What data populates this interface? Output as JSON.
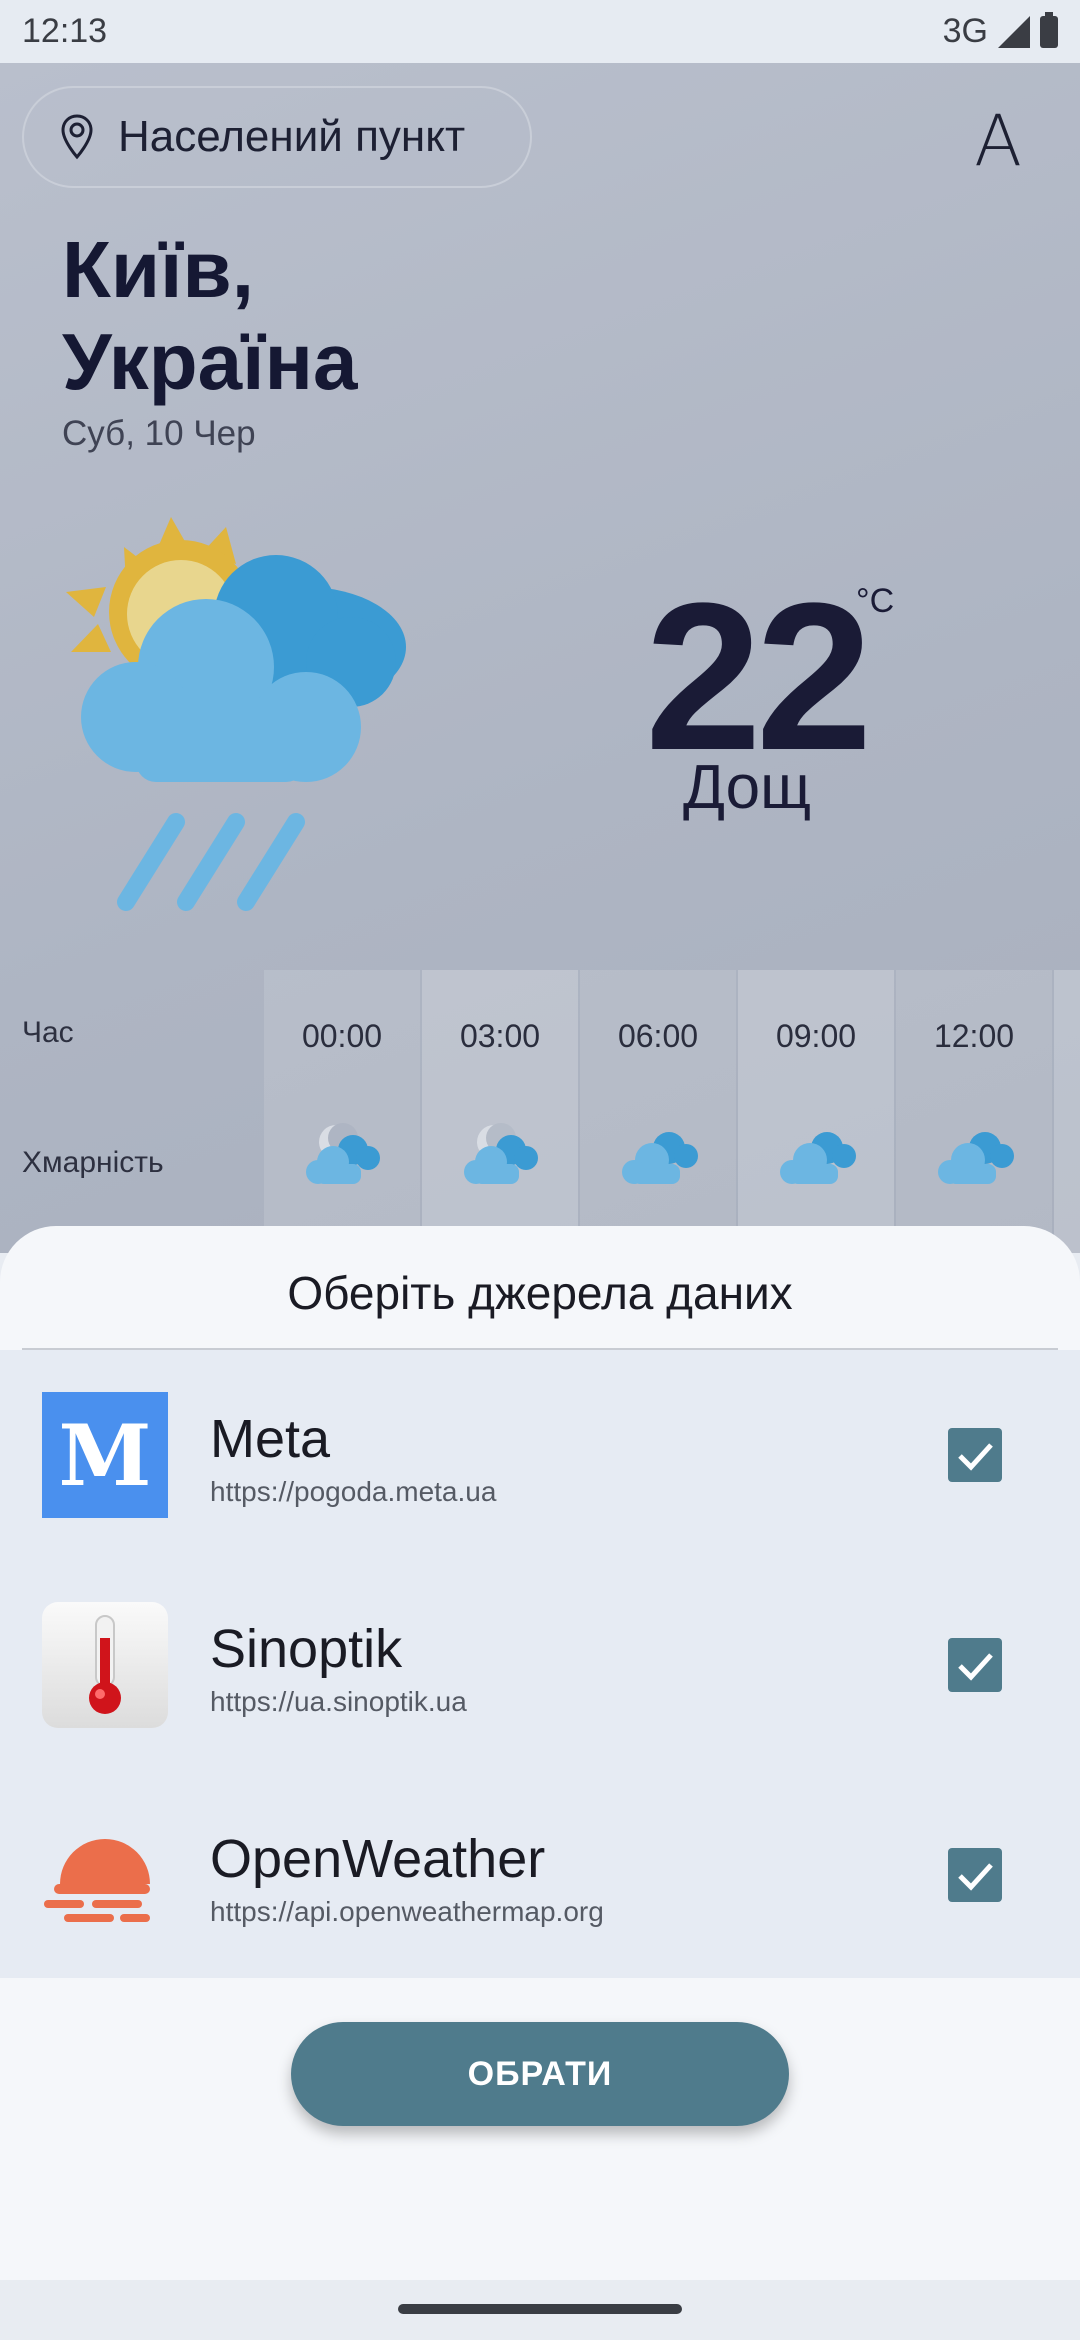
{
  "status_bar": {
    "time": "12:13",
    "network": "3G"
  },
  "header": {
    "location_placeholder": "Населений пункт",
    "font_button": "A"
  },
  "current": {
    "city_line1": "Київ,",
    "city_line2": "Україна",
    "date": "Суб, 10 Чер",
    "temperature": "22",
    "unit": "°C",
    "condition": "Дощ",
    "icon": "sun-cloud-rain-icon"
  },
  "forecast": {
    "time_label": "Час",
    "cloud_label": "Хмарність",
    "times": [
      "00:00",
      "03:00",
      "06:00",
      "09:00",
      "12:00"
    ],
    "icons": [
      "moon-cloud-icon",
      "moon-cloud-icon",
      "cloud-icon",
      "cloud-icon",
      "cloud-icon"
    ]
  },
  "sheet": {
    "title": "Оберіть джерела даних",
    "sources": [
      {
        "name": "Meta",
        "url": "https://pogoda.meta.ua",
        "checked": true,
        "logo": "meta-logo-icon",
        "logo_letter": "M"
      },
      {
        "name": "Sinoptik",
        "url": "https://ua.sinoptik.ua",
        "checked": true,
        "logo": "thermometer-icon"
      },
      {
        "name": "OpenWeather",
        "url": "https://api.openweathermap.org",
        "checked": true,
        "logo": "openweather-sun-icon"
      }
    ],
    "choose_button": "ОБРАТИ"
  },
  "colors": {
    "accent": "#4f7b8c",
    "meta_blue": "#4a90ee",
    "openweather_orange": "#eb6e4b"
  }
}
